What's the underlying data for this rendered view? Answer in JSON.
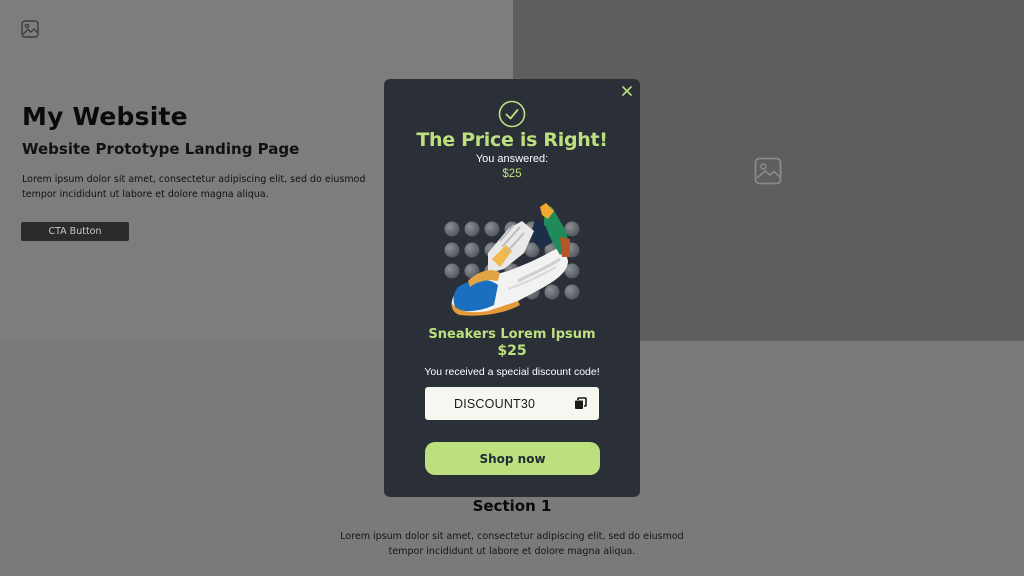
{
  "website": {
    "title": "My Website",
    "subtitle": "Website Prototype Landing Page",
    "hero_text": "Lorem ipsum dolor sit amet, consectetur adipiscing elit, sed do eiusmod tempor incididunt ut labore et dolore magna aliqua.",
    "cta_label": "CTA Button",
    "section_title": "Section 1",
    "section_text": "Lorem ipsum dolor sit amet, consectetur adipiscing elit, sed do eiusmod tempor incididunt ut labore et dolore magna aliqua."
  },
  "modal": {
    "title": "The Price is Right!",
    "answered_label": "You answered:",
    "answer_value": "$25",
    "product_name": "Sneakers Lorem Ipsum",
    "product_price": "$25",
    "discount_message": "You received a special discount code!",
    "discount_code": "DISCOUNT30",
    "shop_button": "Shop now"
  },
  "icons": {
    "close": "close-icon",
    "success": "check-circle-icon",
    "copy": "copy-icon",
    "placeholder": "image-placeholder-icon"
  },
  "colors": {
    "accent": "#bde07e",
    "modal_bg": "#2a2f38",
    "code_bg": "#f7f7f1"
  }
}
